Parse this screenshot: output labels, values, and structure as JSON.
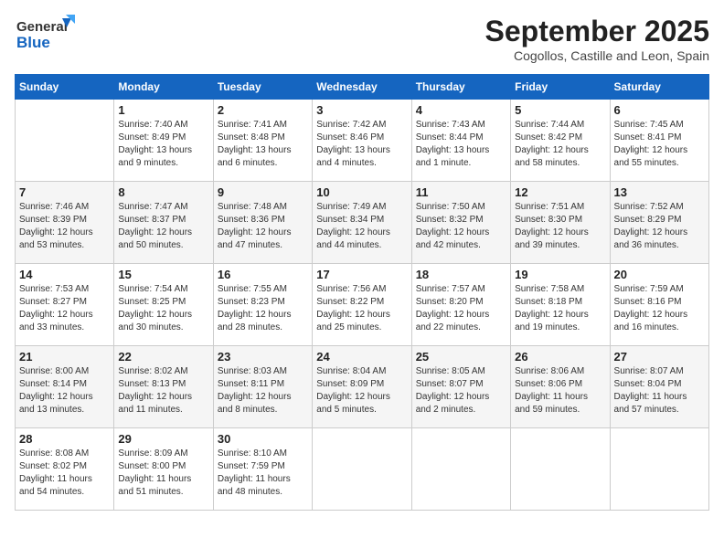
{
  "header": {
    "logo": {
      "line1": "General",
      "line2": "Blue"
    },
    "title": "September 2025",
    "subtitle": "Cogollos, Castille and Leon, Spain"
  },
  "calendar": {
    "days_of_week": [
      "Sunday",
      "Monday",
      "Tuesday",
      "Wednesday",
      "Thursday",
      "Friday",
      "Saturday"
    ],
    "weeks": [
      [
        {
          "day": "",
          "info": ""
        },
        {
          "day": "1",
          "info": "Sunrise: 7:40 AM\nSunset: 8:49 PM\nDaylight: 13 hours\nand 9 minutes."
        },
        {
          "day": "2",
          "info": "Sunrise: 7:41 AM\nSunset: 8:48 PM\nDaylight: 13 hours\nand 6 minutes."
        },
        {
          "day": "3",
          "info": "Sunrise: 7:42 AM\nSunset: 8:46 PM\nDaylight: 13 hours\nand 4 minutes."
        },
        {
          "day": "4",
          "info": "Sunrise: 7:43 AM\nSunset: 8:44 PM\nDaylight: 13 hours\nand 1 minute."
        },
        {
          "day": "5",
          "info": "Sunrise: 7:44 AM\nSunset: 8:42 PM\nDaylight: 12 hours\nand 58 minutes."
        },
        {
          "day": "6",
          "info": "Sunrise: 7:45 AM\nSunset: 8:41 PM\nDaylight: 12 hours\nand 55 minutes."
        }
      ],
      [
        {
          "day": "7",
          "info": "Sunrise: 7:46 AM\nSunset: 8:39 PM\nDaylight: 12 hours\nand 53 minutes."
        },
        {
          "day": "8",
          "info": "Sunrise: 7:47 AM\nSunset: 8:37 PM\nDaylight: 12 hours\nand 50 minutes."
        },
        {
          "day": "9",
          "info": "Sunrise: 7:48 AM\nSunset: 8:36 PM\nDaylight: 12 hours\nand 47 minutes."
        },
        {
          "day": "10",
          "info": "Sunrise: 7:49 AM\nSunset: 8:34 PM\nDaylight: 12 hours\nand 44 minutes."
        },
        {
          "day": "11",
          "info": "Sunrise: 7:50 AM\nSunset: 8:32 PM\nDaylight: 12 hours\nand 42 minutes."
        },
        {
          "day": "12",
          "info": "Sunrise: 7:51 AM\nSunset: 8:30 PM\nDaylight: 12 hours\nand 39 minutes."
        },
        {
          "day": "13",
          "info": "Sunrise: 7:52 AM\nSunset: 8:29 PM\nDaylight: 12 hours\nand 36 minutes."
        }
      ],
      [
        {
          "day": "14",
          "info": "Sunrise: 7:53 AM\nSunset: 8:27 PM\nDaylight: 12 hours\nand 33 minutes."
        },
        {
          "day": "15",
          "info": "Sunrise: 7:54 AM\nSunset: 8:25 PM\nDaylight: 12 hours\nand 30 minutes."
        },
        {
          "day": "16",
          "info": "Sunrise: 7:55 AM\nSunset: 8:23 PM\nDaylight: 12 hours\nand 28 minutes."
        },
        {
          "day": "17",
          "info": "Sunrise: 7:56 AM\nSunset: 8:22 PM\nDaylight: 12 hours\nand 25 minutes."
        },
        {
          "day": "18",
          "info": "Sunrise: 7:57 AM\nSunset: 8:20 PM\nDaylight: 12 hours\nand 22 minutes."
        },
        {
          "day": "19",
          "info": "Sunrise: 7:58 AM\nSunset: 8:18 PM\nDaylight: 12 hours\nand 19 minutes."
        },
        {
          "day": "20",
          "info": "Sunrise: 7:59 AM\nSunset: 8:16 PM\nDaylight: 12 hours\nand 16 minutes."
        }
      ],
      [
        {
          "day": "21",
          "info": "Sunrise: 8:00 AM\nSunset: 8:14 PM\nDaylight: 12 hours\nand 13 minutes."
        },
        {
          "day": "22",
          "info": "Sunrise: 8:02 AM\nSunset: 8:13 PM\nDaylight: 12 hours\nand 11 minutes."
        },
        {
          "day": "23",
          "info": "Sunrise: 8:03 AM\nSunset: 8:11 PM\nDaylight: 12 hours\nand 8 minutes."
        },
        {
          "day": "24",
          "info": "Sunrise: 8:04 AM\nSunset: 8:09 PM\nDaylight: 12 hours\nand 5 minutes."
        },
        {
          "day": "25",
          "info": "Sunrise: 8:05 AM\nSunset: 8:07 PM\nDaylight: 12 hours\nand 2 minutes."
        },
        {
          "day": "26",
          "info": "Sunrise: 8:06 AM\nSunset: 8:06 PM\nDaylight: 11 hours\nand 59 minutes."
        },
        {
          "day": "27",
          "info": "Sunrise: 8:07 AM\nSunset: 8:04 PM\nDaylight: 11 hours\nand 57 minutes."
        }
      ],
      [
        {
          "day": "28",
          "info": "Sunrise: 8:08 AM\nSunset: 8:02 PM\nDaylight: 11 hours\nand 54 minutes."
        },
        {
          "day": "29",
          "info": "Sunrise: 8:09 AM\nSunset: 8:00 PM\nDaylight: 11 hours\nand 51 minutes."
        },
        {
          "day": "30",
          "info": "Sunrise: 8:10 AM\nSunset: 7:59 PM\nDaylight: 11 hours\nand 48 minutes."
        },
        {
          "day": "",
          "info": ""
        },
        {
          "day": "",
          "info": ""
        },
        {
          "day": "",
          "info": ""
        },
        {
          "day": "",
          "info": ""
        }
      ]
    ]
  }
}
